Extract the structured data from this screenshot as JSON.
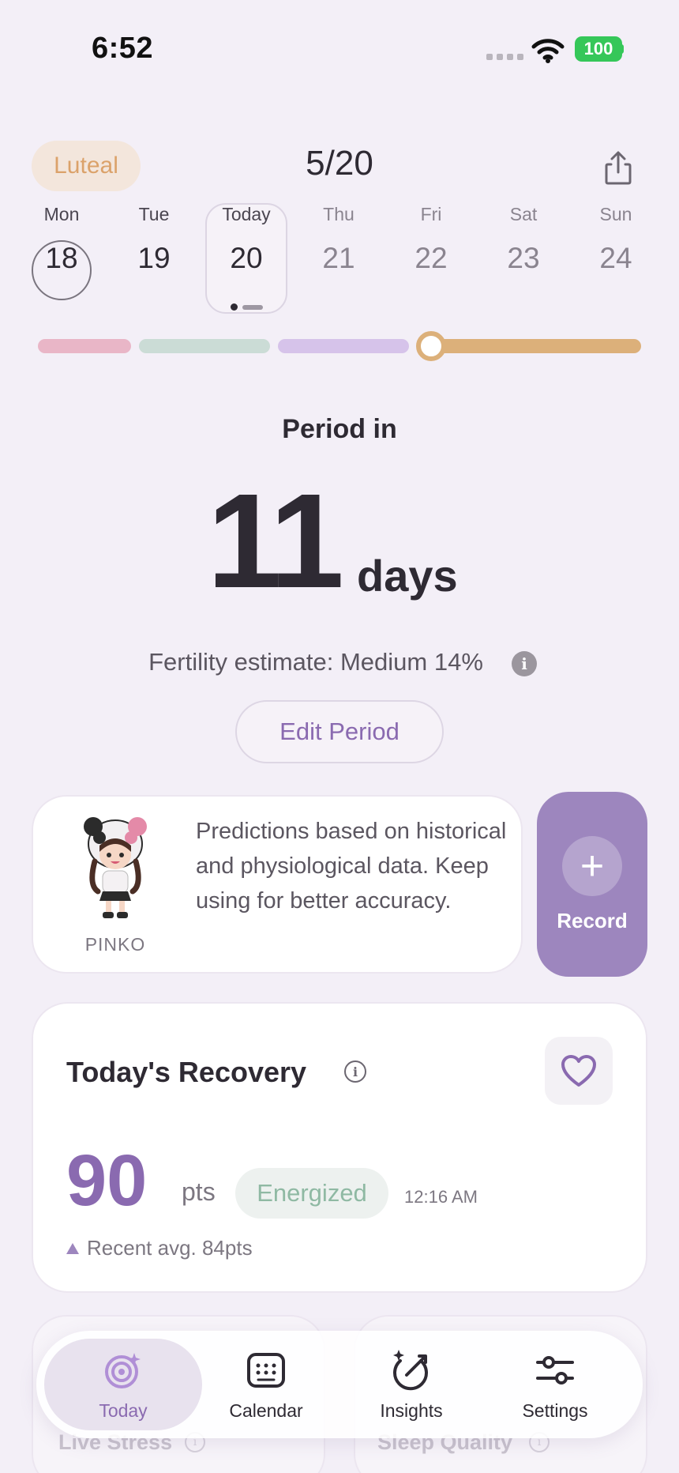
{
  "status_bar": {
    "time": "6:52",
    "battery": "100"
  },
  "header": {
    "phase": "Luteal",
    "date": "5/20",
    "share_icon": "share-icon"
  },
  "week": [
    {
      "name": "Mon",
      "num": "18"
    },
    {
      "name": "Tue",
      "num": "19"
    },
    {
      "name": "Today",
      "num": "20"
    },
    {
      "name": "Thu",
      "num": "21"
    },
    {
      "name": "Fri",
      "num": "22"
    },
    {
      "name": "Sat",
      "num": "23"
    },
    {
      "name": "Sun",
      "num": "24"
    }
  ],
  "cycle_bar": {
    "phase_colors": [
      "#e9b6c7",
      "#cbdcd6",
      "#d6c3ea",
      "#dcb07a"
    ]
  },
  "countdown": {
    "label": "Period in",
    "value": "11",
    "unit": "days",
    "fertility": "Fertility estimate: Medium 14%",
    "edit_label": "Edit Period"
  },
  "prediction": {
    "mascot_name": "PINKO",
    "text": "Predictions based on historical and physiological data. Keep using for better accuracy."
  },
  "record": {
    "label": "Record",
    "icon": "plus-icon"
  },
  "recovery": {
    "title": "Today's Recovery",
    "score": "90",
    "unit": "pts",
    "status": "Energized",
    "time": "12:16 AM",
    "recent_avg": "Recent avg. 84pts",
    "heart_icon": "heart-icon"
  },
  "peek_cards": {
    "left_label": "Live Stress",
    "right_label": "Sleep Quality"
  },
  "tabs": [
    {
      "label": "Today",
      "icon": "today-icon",
      "active": true
    },
    {
      "label": "Calendar",
      "icon": "calendar-icon",
      "active": false
    },
    {
      "label": "Insights",
      "icon": "insights-icon",
      "active": false
    },
    {
      "label": "Settings",
      "icon": "settings-icon",
      "active": false
    }
  ],
  "colors": {
    "accent": "#8a6ab0",
    "record_button": "#9d86be",
    "phase_badge": "#dba26a",
    "energized": "#8fb9a3",
    "battery": "#35c759"
  }
}
